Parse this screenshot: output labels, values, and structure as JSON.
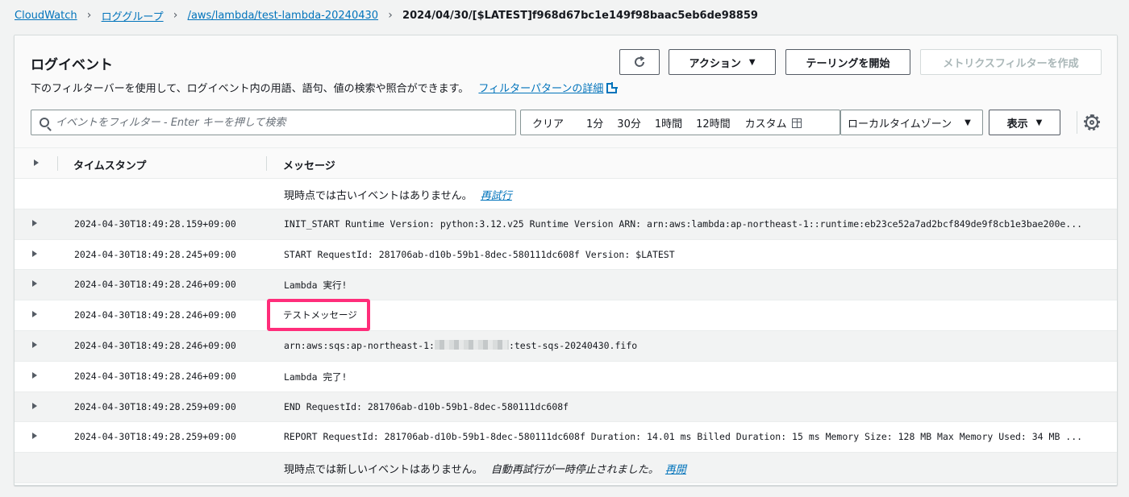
{
  "breadcrumb": {
    "items": [
      "CloudWatch",
      "ロググループ",
      "/aws/lambda/test-lambda-20240430"
    ],
    "current": "2024/04/30/[$LATEST]f968d67bc1e149f98baac5eb6de98859"
  },
  "panel": {
    "title": "ログイベント",
    "description": "下のフィルターバーを使用して、ログイベント内の用語、語句、値の検索や照合ができます。",
    "description_link": "フィルターパターンの詳細"
  },
  "toolbar": {
    "refresh_icon": "refresh-icon",
    "actions_label": "アクション",
    "tail_label": "テーリングを開始",
    "metric_filter_label": "メトリクスフィルターを作成"
  },
  "filter": {
    "placeholder": "イベントをフィルター - Enter キーを押して検索",
    "ranges": [
      "クリア",
      "1分",
      "30分",
      "1時間",
      "12時間"
    ],
    "custom_label": "カスタム",
    "timezone": "ローカルタイムゾーン",
    "display_label": "表示"
  },
  "table": {
    "headers": {
      "timestamp": "タイムスタンプ",
      "message": "メッセージ"
    },
    "top_note": "現時点では古いイベントはありません。",
    "top_retry": "再試行",
    "rows": [
      {
        "timestamp": "2024-04-30T18:49:28.159+09:00",
        "message": "INIT_START Runtime Version: python:3.12.v25 Runtime Version ARN: arn:aws:lambda:ap-northeast-1::runtime:eb23ce52a7ad2bcf849de9f8cb1e3bae200e..."
      },
      {
        "timestamp": "2024-04-30T18:49:28.245+09:00",
        "message": "START RequestId: 281706ab-d10b-59b1-8dec-580111dc608f Version: $LATEST"
      },
      {
        "timestamp": "2024-04-30T18:49:28.246+09:00",
        "message": "Lambda 実行!"
      },
      {
        "timestamp": "2024-04-30T18:49:28.246+09:00",
        "message": "テストメッセージ"
      },
      {
        "timestamp": "2024-04-30T18:49:28.246+09:00",
        "message_prefix": "arn:aws:sqs:ap-northeast-1:",
        "message_suffix": ":test-sqs-20240430.fifo"
      },
      {
        "timestamp": "2024-04-30T18:49:28.246+09:00",
        "message": "Lambda 完了!"
      },
      {
        "timestamp": "2024-04-30T18:49:28.259+09:00",
        "message": "END RequestId: 281706ab-d10b-59b1-8dec-580111dc608f"
      },
      {
        "timestamp": "2024-04-30T18:49:28.259+09:00",
        "message": "REPORT RequestId: 281706ab-d10b-59b1-8dec-580111dc608f Duration: 14.01 ms Billed Duration: 15 ms Memory Size: 128 MB Max Memory Used: 34 MB ..."
      }
    ],
    "bottom_note": "現時点では新しいイベントはありません。",
    "bottom_paused": "自動再試行が一時停止されました。",
    "bottom_resume": "再開"
  }
}
